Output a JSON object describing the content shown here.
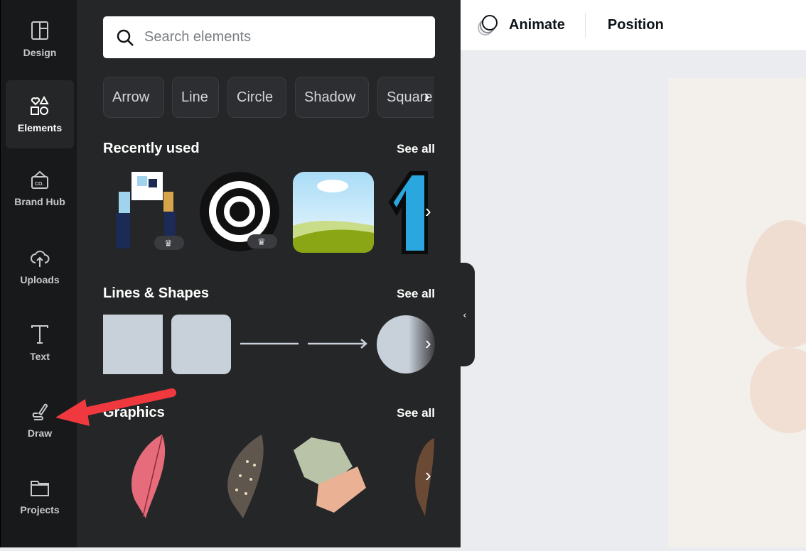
{
  "sidebar": {
    "items": [
      {
        "label": "Design",
        "icon": "layout-icon"
      },
      {
        "label": "Elements",
        "icon": "shapes-icon",
        "active": true
      },
      {
        "label": "Brand Hub",
        "icon": "brand-hub-icon"
      },
      {
        "label": "Uploads",
        "icon": "cloud-upload-icon"
      },
      {
        "label": "Text",
        "icon": "text-icon"
      },
      {
        "label": "Draw",
        "icon": "draw-icon"
      },
      {
        "label": "Projects",
        "icon": "folder-icon"
      }
    ]
  },
  "panel": {
    "search_placeholder": "Search elements",
    "chips": [
      "Arrow",
      "Line",
      "Circle",
      "Shadow",
      "Square"
    ],
    "sections": [
      {
        "title": "Recently used",
        "see_all": "See all"
      },
      {
        "title": "Lines & Shapes",
        "see_all": "See all"
      },
      {
        "title": "Graphics",
        "see_all": "See all"
      }
    ]
  },
  "toolbar": {
    "animate": "Animate",
    "position": "Position"
  },
  "colors": {
    "annotation_arrow": "#f0393f",
    "sidebar_bg": "#18191b",
    "panel_bg": "#252627"
  }
}
